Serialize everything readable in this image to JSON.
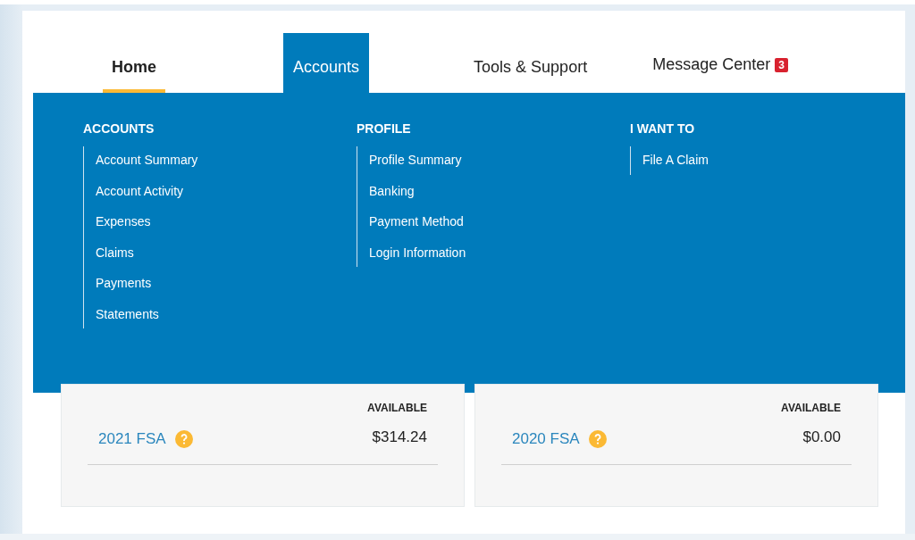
{
  "nav_tabs": [
    {
      "label": "Home",
      "selected": true,
      "expanded": false
    },
    {
      "label": "Accounts",
      "selected": false,
      "expanded": true
    },
    {
      "label": "Tools & Support",
      "selected": false,
      "expanded": false
    },
    {
      "label": "Message Center",
      "selected": false,
      "expanded": false,
      "badge": "3"
    }
  ],
  "menu": {
    "columns": [
      {
        "heading": "ACCOUNTS",
        "items": [
          "Account Summary",
          "Account Activity",
          "Expenses",
          "Claims",
          "Payments",
          "Statements"
        ]
      },
      {
        "heading": "PROFILE",
        "items": [
          "Profile Summary",
          "Banking",
          "Payment Method",
          "Login Information"
        ]
      },
      {
        "heading": "I WANT TO",
        "items": [
          "File A Claim"
        ]
      }
    ]
  },
  "cards": [
    {
      "column_label": "AVAILABLE",
      "account": "2021 FSA",
      "amount": "$314.24"
    },
    {
      "column_label": "AVAILABLE",
      "account": "2020 FSA",
      "amount": "$0.00"
    }
  ]
}
